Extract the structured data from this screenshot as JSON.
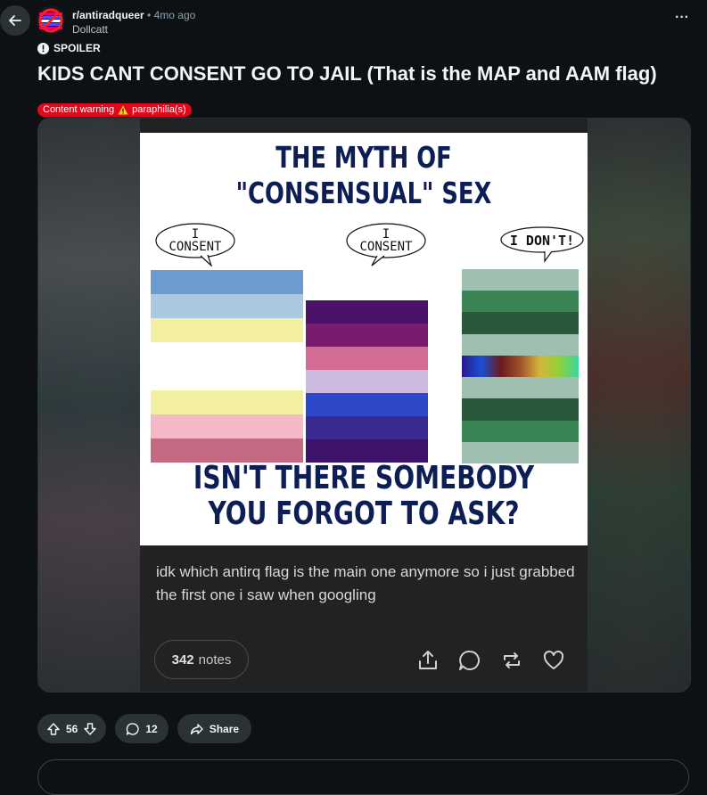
{
  "post": {
    "subreddit": "r/antiradqueer",
    "separator": "•",
    "time_ago": "4mo ago",
    "author": "Dollcatt",
    "spoiler_label": "SPOILER",
    "title": "KIDS CANT CONSENT GO TO JAIL (That is the MAP and AAM flag)",
    "content_warning": {
      "label": "Content warning",
      "tag": "paraphilia(s)",
      "icon": "warning-icon"
    }
  },
  "meme": {
    "top_text": "THE MYTH OF \"CONSENSUAL\" SEX",
    "bottom_text": "ISN'T THERE SOMEBODY YOU FORGOT TO ASK?",
    "bubbles": [
      {
        "line1": "I",
        "line2": "CONSENT"
      },
      {
        "line1": "I",
        "line2": "CONSENT"
      },
      {
        "line1": "",
        "line2": "I DON'T!"
      }
    ],
    "flags": [
      {
        "colors": [
          "#6b9bd1",
          "#a8c9e0",
          "#f2efa0",
          "#ffffff",
          "#ffffff",
          "#f2efa0",
          "#f4b8c6",
          "#c46b83"
        ]
      },
      {
        "colors": [
          "#4c1267",
          "#7a1c6e",
          "#d46d96",
          "#cdbadf",
          "#2d49c9",
          "#3b2a8f",
          "#3d136b"
        ]
      },
      {
        "colors": [
          "#9fc0b0",
          "#3a8455",
          "#29593a",
          "#9fc0b0",
          "rainbow",
          "#9fc0b0",
          "#29593a",
          "#3a8455",
          "#9fc0b0"
        ]
      }
    ]
  },
  "tumblr": {
    "caption": "idk which antirq flag is the main one anymore so i just grabbed the first one i saw when googling",
    "notes_count": "342",
    "notes_label": "notes",
    "icons": [
      "share-icon",
      "reply-icon",
      "reblog-icon",
      "like-icon"
    ]
  },
  "actions": {
    "upvotes": "56",
    "comments": "12",
    "share_label": "Share"
  },
  "colors": {
    "background": "#0e1113",
    "pill": "#2a3236",
    "content_warning": "#e0081d",
    "meme_text": "#0d1e54"
  }
}
